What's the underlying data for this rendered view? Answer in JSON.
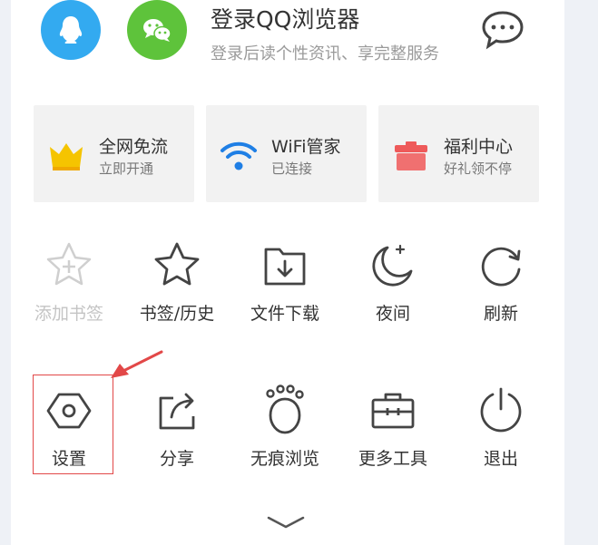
{
  "login": {
    "title": "登录QQ浏览器",
    "subtitle": "登录后读个性资讯、享完整服务"
  },
  "cards": [
    {
      "title": "全网免流",
      "subtitle": "立即开通",
      "icon": "crown-icon",
      "color": "#f5c400"
    },
    {
      "title": "WiFi管家",
      "subtitle": "已连接",
      "icon": "wifi-icon",
      "color": "#1f7fe5"
    },
    {
      "title": "福利中心",
      "subtitle": "好礼领不停",
      "icon": "gift-icon",
      "color": "#ee5a5a"
    }
  ],
  "tools_row1": [
    {
      "label": "添加书签",
      "icon": "star-add-icon",
      "enabled": false
    },
    {
      "label": "书签/历史",
      "icon": "star-icon",
      "enabled": true
    },
    {
      "label": "文件下载",
      "icon": "folder-download-icon",
      "enabled": true
    },
    {
      "label": "夜间",
      "icon": "moon-icon",
      "enabled": true
    },
    {
      "label": "刷新",
      "icon": "refresh-icon",
      "enabled": true
    }
  ],
  "tools_row2": [
    {
      "label": "设置",
      "icon": "hexagon-settings-icon",
      "enabled": true,
      "highlighted": true
    },
    {
      "label": "分享",
      "icon": "share-icon",
      "enabled": true
    },
    {
      "label": "无痕浏览",
      "icon": "paw-icon",
      "enabled": true
    },
    {
      "label": "更多工具",
      "icon": "toolbox-icon",
      "enabled": true
    },
    {
      "label": "退出",
      "icon": "power-icon",
      "enabled": true
    }
  ],
  "colors": {
    "text": "#333333",
    "muted": "#9a9a9a",
    "disabled": "#c4c4c4",
    "annotation": "#e24848",
    "qq": "#33aaf0",
    "wechat": "#5ec33b"
  }
}
